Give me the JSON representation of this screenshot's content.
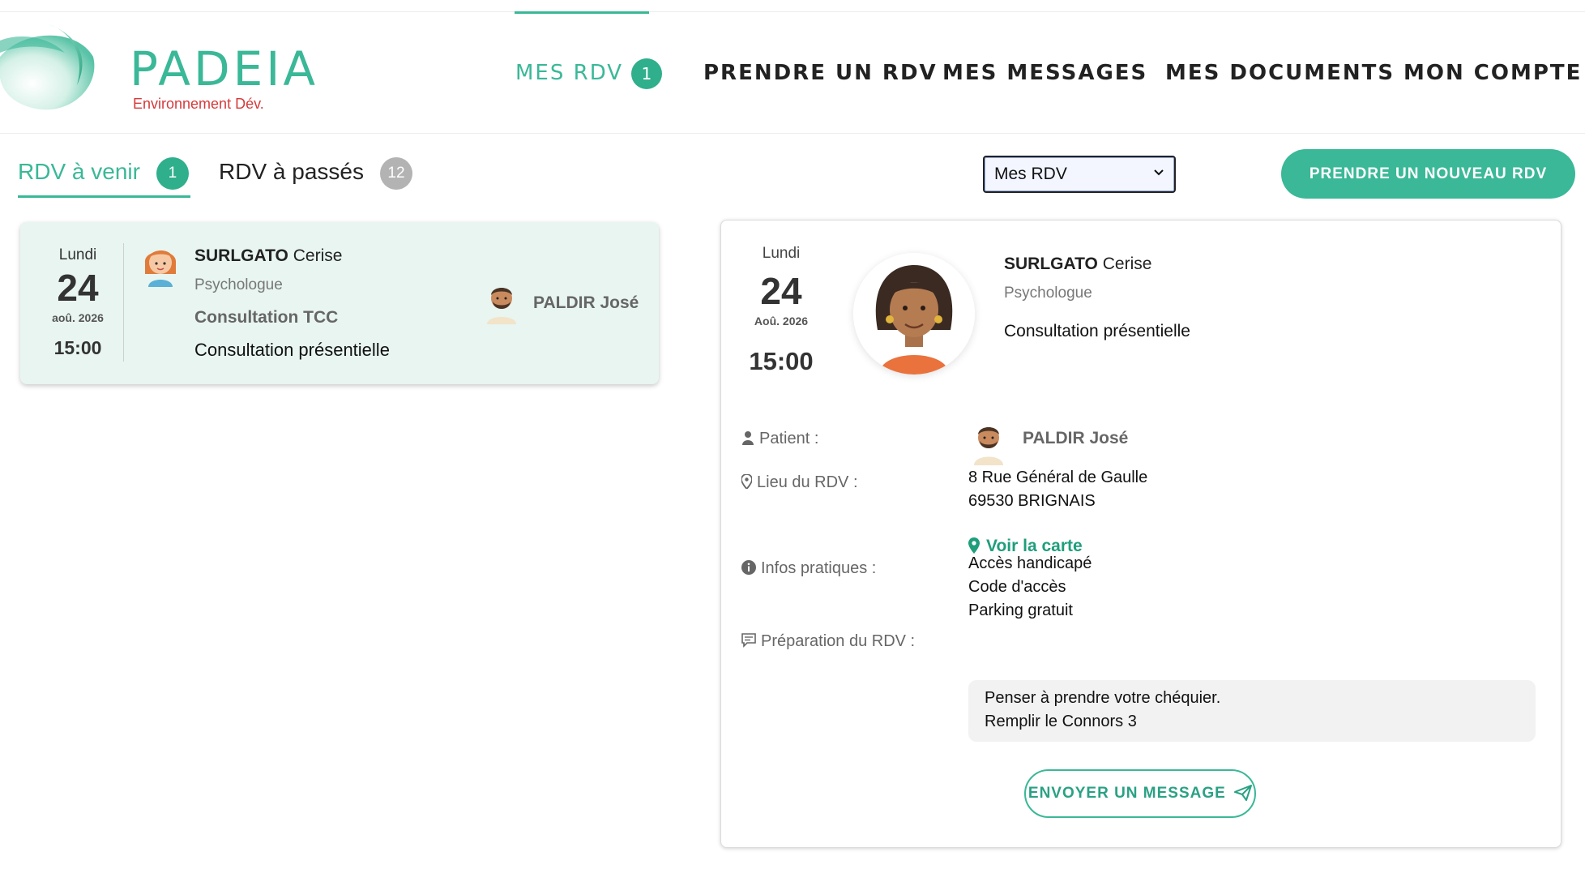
{
  "brand": {
    "name": "PADEIA",
    "env": "Environnement Dév.",
    "color": "#3ab897",
    "env_color": "#d63a3a"
  },
  "nav": {
    "items": [
      {
        "label": "MES RDV",
        "badge": "1",
        "active": true
      },
      {
        "label": "PRENDRE UN RDV"
      },
      {
        "label": "MES MESSAGES"
      },
      {
        "label": "MES DOCUMENTS"
      },
      {
        "label": "MON COMPTE"
      }
    ]
  },
  "tabs": [
    {
      "label": "RDV à venir",
      "count": "1",
      "active": true
    },
    {
      "label": "RDV à passés",
      "count": "12"
    }
  ],
  "filter": {
    "selected": "Mes RDV"
  },
  "new_button": {
    "label": "PRENDRE UN NOUVEAU RDV"
  },
  "card": {
    "weekday": "Lundi",
    "day": "24",
    "month_year": "aoû. 2026",
    "time": "15:00",
    "practitioner_last": "SURLGATO",
    "practitioner_first": "Cerise",
    "role": "Psychologue",
    "motif": "Consultation TCC",
    "mode": "Consultation présentielle",
    "patient": "PALDIR José"
  },
  "detail": {
    "weekday": "Lundi",
    "day": "24",
    "month_year": "Aoû. 2026",
    "time": "15:00",
    "practitioner_last": "SURLGATO",
    "practitioner_first": "Cerise",
    "role": "Psychologue",
    "mode": "Consultation présentielle",
    "patient_label": "Patient :",
    "patient_name": "PALDIR José",
    "location_label": "Lieu du RDV :",
    "address_line1": "8 Rue Général de Gaulle",
    "address_line2": "69530 BRIGNAIS",
    "map_link": "Voir la carte",
    "info_label": "Infos pratiques :",
    "info_lines": [
      "Accès handicapé",
      "Code d'accès",
      "Parking gratuit"
    ],
    "prep_label": "Préparation du RDV :",
    "prep_lines": [
      "Penser à prendre votre chéquier.",
      "Remplir le Connors 3"
    ],
    "message_button": "ENVOYER UN MESSAGE"
  }
}
